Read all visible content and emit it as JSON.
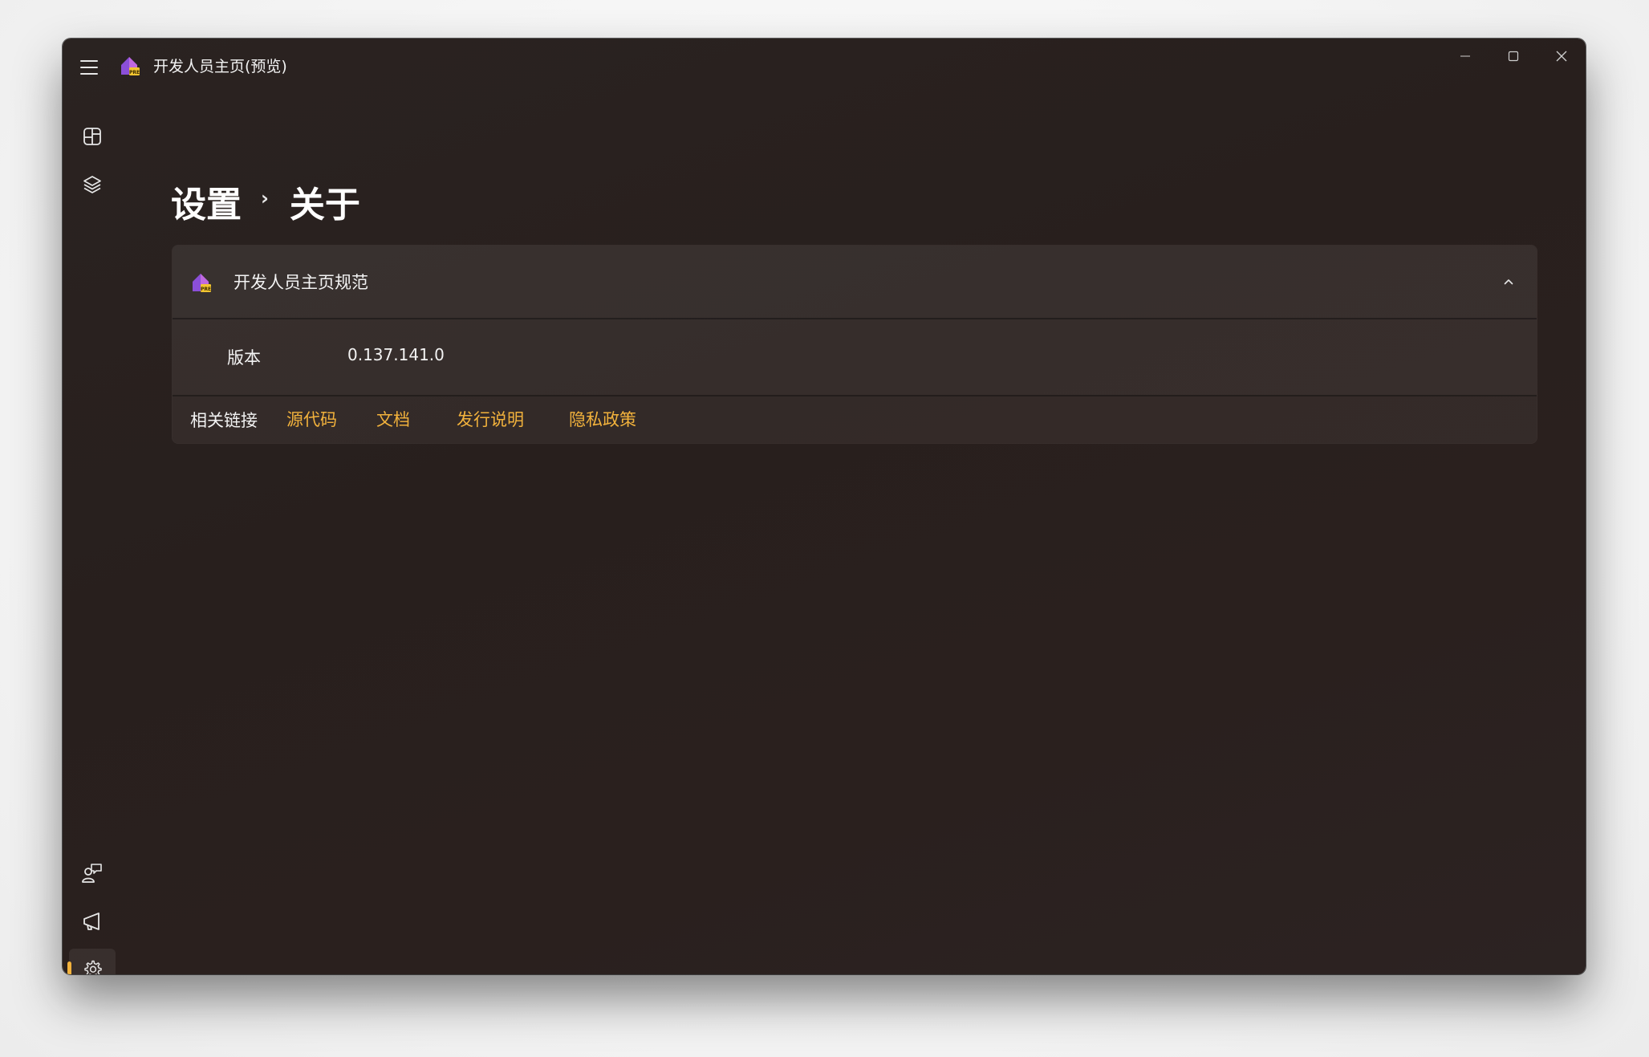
{
  "app": {
    "title": "开发人员主页(预览)"
  },
  "nav": {
    "top": [
      {
        "icon": "dashboard-icon"
      },
      {
        "icon": "layers-icon"
      }
    ],
    "bottom": [
      {
        "icon": "feedback-icon"
      },
      {
        "icon": "announcement-icon"
      },
      {
        "icon": "gear-icon",
        "selected": true
      }
    ]
  },
  "breadcrumb": {
    "parent": "设置",
    "separator": "›",
    "current": "关于"
  },
  "about_card": {
    "title": "开发人员主页规范",
    "expanded": true,
    "version_label": "版本",
    "version_value": "0.137.141.0",
    "links_label": "相关链接",
    "links": [
      "源代码",
      "文档",
      "发行说明",
      "隐私政策"
    ]
  },
  "colors": {
    "accent": "#f2b23c",
    "window_bg": "#2a211f",
    "text": "#ffffff"
  }
}
